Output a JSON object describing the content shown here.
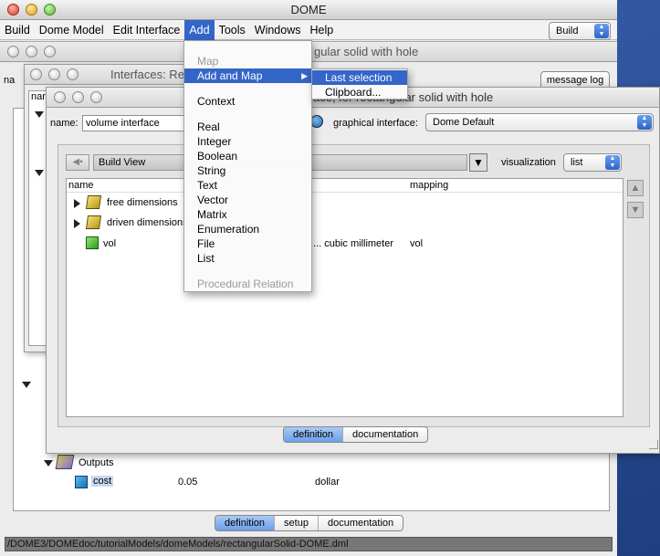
{
  "main": {
    "title": "DOME",
    "menu": [
      "Build",
      "Dome Model",
      "Edit Interface",
      "Add",
      "Tools",
      "Windows",
      "Help"
    ],
    "mode_value": "Build",
    "outputs_label": "Outputs",
    "cost": {
      "name": "cost",
      "value": "0.05",
      "unit": "dollar"
    },
    "tabs": [
      "definition",
      "setup",
      "documentation"
    ],
    "status_path": "/DOME3/DOMEdoc/tutorialModels/domeModels/rectangularSolid-DOME.dml"
  },
  "model_window": {
    "title_frag": "gular solid with hole",
    "name_label_frag": "na",
    "message_log": "message log"
  },
  "interfaces_window": {
    "title_frag": "Interfaces: Re",
    "col_frag": "nam"
  },
  "iface": {
    "title_frag": "ace, for rectangular solid with hole",
    "title_frag2": "ace, for rectangular solid with hole",
    "name_label": "name:",
    "name_value": "volume interface",
    "graphical_label": "graphical interface:",
    "graphical_value": "Dome Default",
    "view_value": "Build View",
    "visualization_label": "visualization",
    "visualization_value": "list",
    "columns": {
      "name": "name",
      "mapping": "mapping"
    },
    "rows": [
      {
        "name": "free dimensions",
        "value": "",
        "mapping": ""
      },
      {
        "name": "driven dimensions",
        "value": "",
        "mapping": ""
      },
      {
        "name": "vol",
        "value": "... cubic millimeter",
        "mapping": "vol"
      }
    ],
    "tabs": [
      "definition",
      "documentation"
    ]
  },
  "add_menu": {
    "items": [
      {
        "label": "Map",
        "state": "disabled"
      },
      {
        "label": "Add and Map",
        "state": "highlighted",
        "submenu": true
      },
      {
        "label": "",
        "state": "separator"
      },
      {
        "label": "Context",
        "state": "normal"
      },
      {
        "label": "",
        "state": "separator"
      },
      {
        "label": "Real",
        "state": "normal"
      },
      {
        "label": "Integer",
        "state": "normal"
      },
      {
        "label": "Boolean",
        "state": "normal"
      },
      {
        "label": "String",
        "state": "normal"
      },
      {
        "label": "Text",
        "state": "normal"
      },
      {
        "label": "Vector",
        "state": "normal"
      },
      {
        "label": "Matrix",
        "state": "normal"
      },
      {
        "label": "Enumeration",
        "state": "normal"
      },
      {
        "label": "File",
        "state": "normal"
      },
      {
        "label": "List",
        "state": "normal"
      },
      {
        "label": "",
        "state": "separator"
      },
      {
        "label": "Procedural Relation",
        "state": "disabled"
      }
    ],
    "submenu": [
      "Last selection",
      "Clipboard..."
    ]
  },
  "colors": {
    "accent": "#3465c9",
    "desktop": "#2a4d95"
  }
}
